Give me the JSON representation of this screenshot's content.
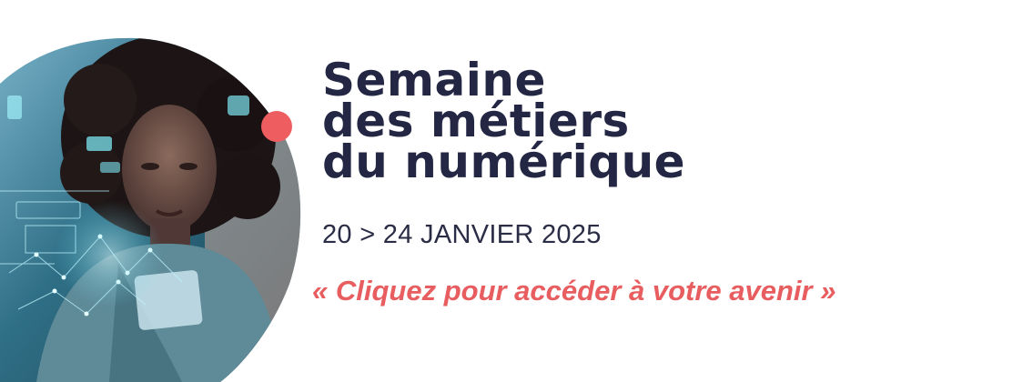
{
  "banner": {
    "title_lines": [
      "Semaine",
      "des métiers",
      "du numérique"
    ],
    "dates": "20 > 24 JANVIER 2025",
    "cta_label": "« Cliquez pour accéder à votre avenir »"
  },
  "photo": {
    "subject": "woman-using-holographic-interface-icon"
  },
  "colors": {
    "title": "#232744",
    "dates": "#2a2d45",
    "cta": "#e85d5f",
    "accent_dot": "#ee5e60",
    "photo_tint": "#1f6f86"
  }
}
